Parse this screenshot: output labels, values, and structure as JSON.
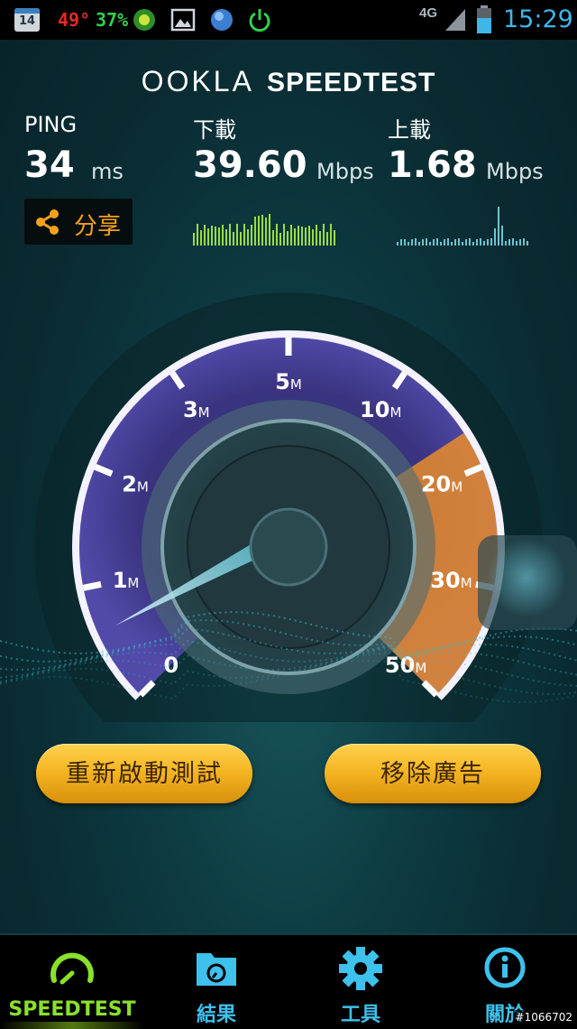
{
  "status_bar": {
    "date_day": "14",
    "temperature": "49°",
    "battery_percent": "37%",
    "network": "4G",
    "time": "15:29",
    "icons": [
      "calendar-icon",
      "shield-app-icon",
      "gallery-icon",
      "globe-icon",
      "power-icon",
      "signal-icon",
      "battery-icon"
    ]
  },
  "header": {
    "brand": "OOKLA",
    "product": "SPEEDTEST"
  },
  "stats": {
    "ping": {
      "label": "PING",
      "value": "34",
      "unit": "ms"
    },
    "download": {
      "label": "下載",
      "value": "39.60",
      "unit": "Mbps"
    },
    "upload": {
      "label": "上載",
      "value": "1.68",
      "unit": "Mbps"
    }
  },
  "share": {
    "label": "分享",
    "icon": "share-icon"
  },
  "gauge": {
    "scale_labels": [
      {
        "num": "0",
        "unit": ""
      },
      {
        "num": "1",
        "unit": "M"
      },
      {
        "num": "2",
        "unit": "M"
      },
      {
        "num": "3",
        "unit": "M"
      },
      {
        "num": "5",
        "unit": "M"
      },
      {
        "num": "10",
        "unit": "M"
      },
      {
        "num": "20",
        "unit": "M"
      },
      {
        "num": "30",
        "unit": "M"
      },
      {
        "num": "50",
        "unit": "M"
      }
    ],
    "needle_value": "0",
    "colors": {
      "arc": "#7f5fd0",
      "high_zone": "#e98c2c",
      "accent": "#7fe0f0"
    }
  },
  "buttons": {
    "restart": "重新啟動測試",
    "remove_ads": "移除廣告"
  },
  "nav": {
    "items": [
      {
        "label": "SPEEDTEST",
        "icon": "speedometer-icon",
        "active": true
      },
      {
        "label": "結果",
        "icon": "results-folder-icon",
        "active": false
      },
      {
        "label": "工具",
        "icon": "gear-icon",
        "active": false
      },
      {
        "label": "關於",
        "icon": "info-icon",
        "active": false
      }
    ]
  },
  "watermark": "#1066702"
}
